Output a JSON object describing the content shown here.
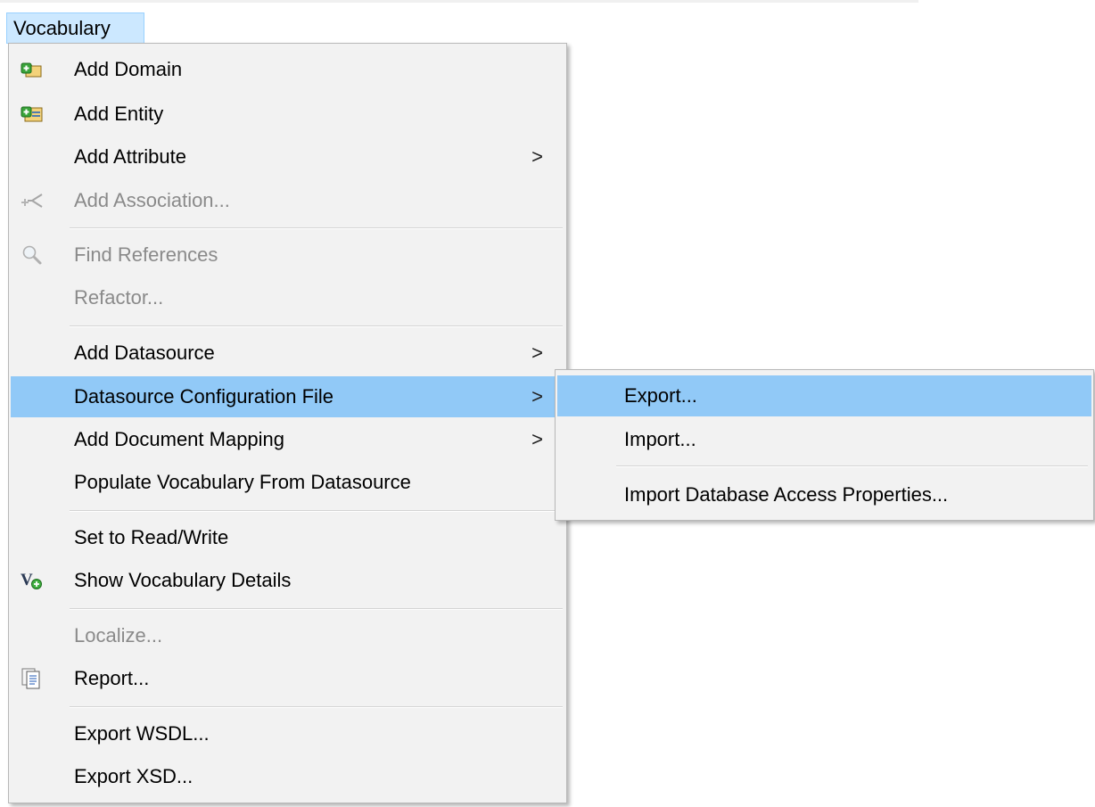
{
  "menubar": {
    "active_menu": "Vocabulary"
  },
  "main_menu": {
    "items": [
      {
        "label": "Add Domain",
        "icon": "add-domain-icon"
      },
      {
        "label": "Add Entity",
        "icon": "add-entity-icon"
      },
      {
        "label": "Add Attribute",
        "submenu_arrow": ">"
      },
      {
        "label": "Add Association...",
        "icon": "add-association-icon",
        "disabled": true
      },
      {
        "label": "Find References",
        "icon": "magnifier-icon",
        "disabled": true
      },
      {
        "label": "Refactor...",
        "disabled": true
      },
      {
        "label": "Add Datasource",
        "submenu_arrow": ">"
      },
      {
        "label": "Datasource Configuration File",
        "submenu_arrow": ">",
        "highlighted": true
      },
      {
        "label": "Add Document Mapping",
        "submenu_arrow": ">"
      },
      {
        "label": "Populate Vocabulary From Datasource"
      },
      {
        "label": "Set to Read/Write"
      },
      {
        "label": "Show Vocabulary Details",
        "icon": "vocabulary-details-icon"
      },
      {
        "label": "Localize...",
        "disabled": true
      },
      {
        "label": "Report...",
        "icon": "report-icon"
      },
      {
        "label": "Export WSDL..."
      },
      {
        "label": "Export XSD..."
      }
    ]
  },
  "submenu": {
    "parent": "Datasource Configuration File",
    "items": [
      {
        "label": "Export...",
        "highlighted": true
      },
      {
        "label": "Import..."
      },
      {
        "label": "Import Database Access Properties..."
      }
    ]
  },
  "colors": {
    "menu_background": "#f2f2f2",
    "highlight": "#91c9f7",
    "menubar_active": "#cce8ff",
    "disabled_text": "#8a8a8a"
  }
}
